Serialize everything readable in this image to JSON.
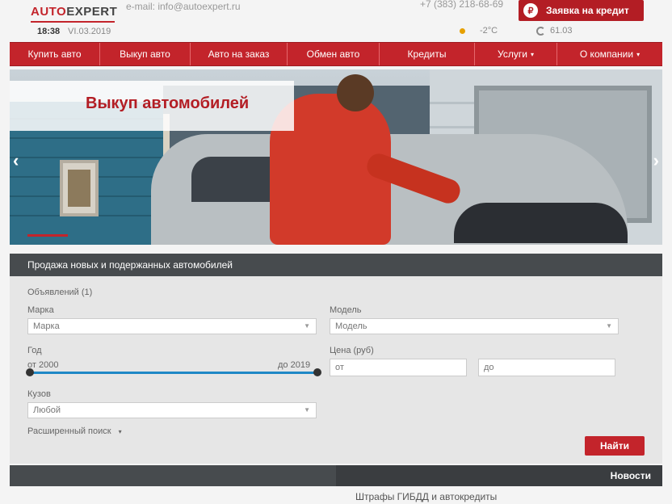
{
  "header": {
    "logo_auto": "AUTO",
    "logo_expert": "EXPERT",
    "time": "18:38",
    "date": "VI.03.2019",
    "email": "e-mail: info@autoexpert.ru",
    "phone": "+7 (383) 218-68-69",
    "weather": "-2°C",
    "exchange_rate": "61.03",
    "credit_button": "Заявка на кредит",
    "credit_icon": "₽"
  },
  "nav": {
    "items": [
      {
        "label": "Купить авто"
      },
      {
        "label": "Выкуп авто"
      },
      {
        "label": "Авто на заказ"
      },
      {
        "label": "Обмен авто"
      },
      {
        "label": "Кредиты"
      },
      {
        "label": "Услуги",
        "caret": "▾"
      },
      {
        "label": "О компании",
        "caret": "▾"
      }
    ]
  },
  "banner": {
    "title": "Выкуп автомобилей",
    "arrow_left": "‹",
    "arrow_right": "›"
  },
  "search": {
    "title": "Продажа новых и подержанных автомобилей",
    "count_label": "Объявлений (1)",
    "brand_label": "Марка",
    "brand_value": "Марка",
    "model_label": "Модель",
    "model_value": "Модель",
    "year_label": "Год",
    "year_from": "от 2000",
    "year_to": "до 2019",
    "price_label": "Цена (руб)",
    "price_from": "от",
    "price_to": "до",
    "body_label": "Кузов",
    "body_value": "Любой",
    "extended_search": "Расширенный поиск",
    "extended_caret": "▾",
    "find_button": "Найти"
  },
  "news": {
    "title": "Новости",
    "item": "Штрафы ГИБДД и автокредиты"
  },
  "colors": {
    "brand_red": "#c3242b",
    "dark_bar": "#474b4e",
    "slider_blue": "#1f88c6"
  }
}
